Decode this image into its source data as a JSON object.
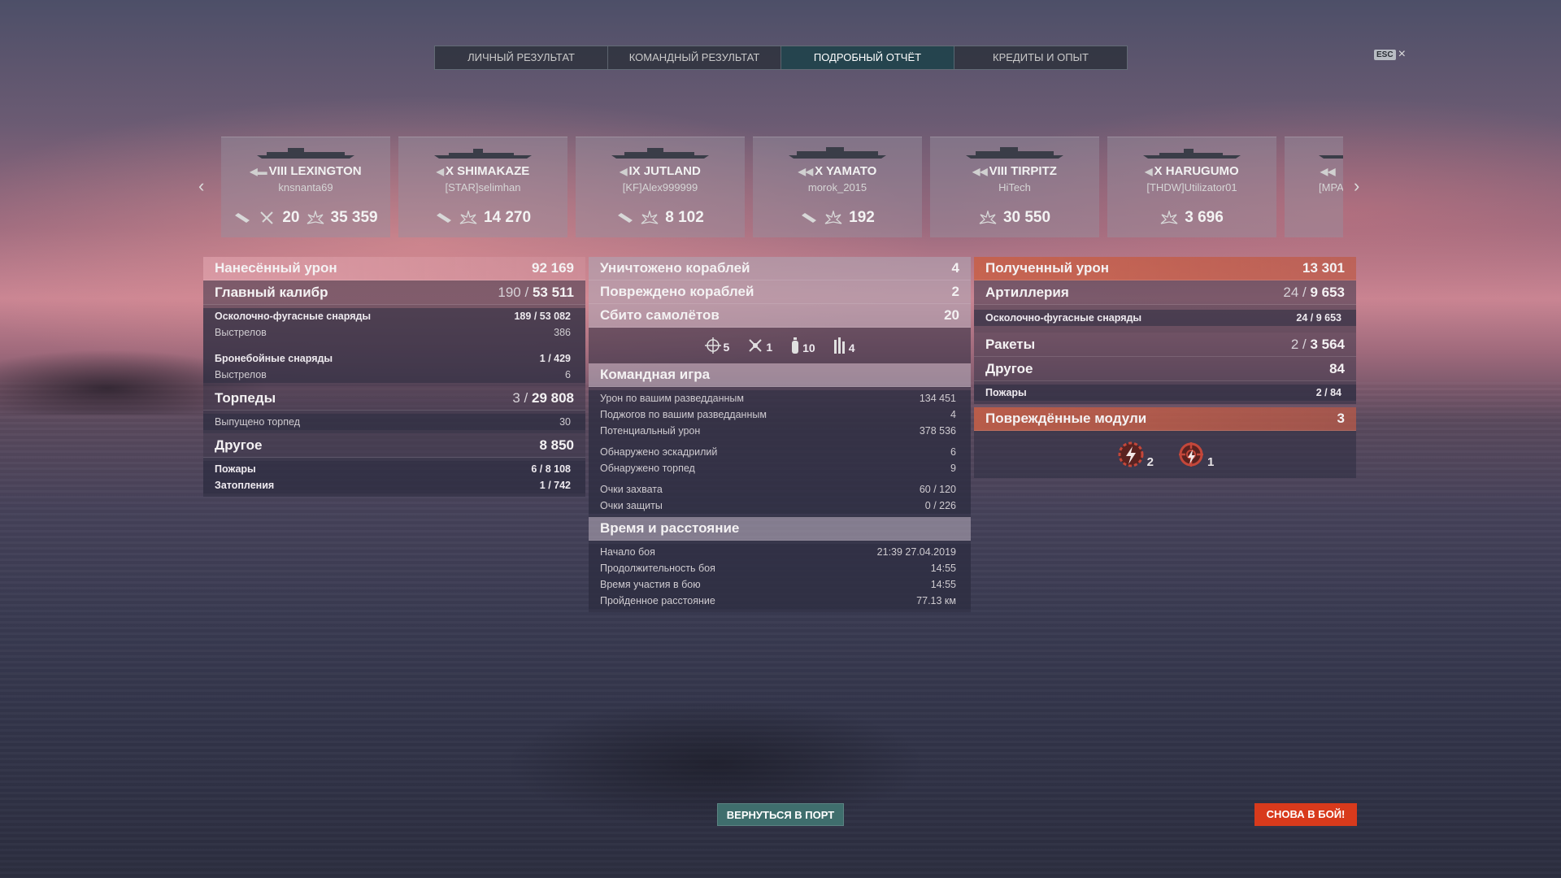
{
  "tabs": [
    {
      "label": "ЛИЧНЫЙ РЕЗУЛЬТАТ"
    },
    {
      "label": "КОМАНДНЫЙ РЕЗУЛЬТАТ"
    },
    {
      "label": "ПОДРОБНЫЙ ОТЧЁТ",
      "active": true
    },
    {
      "label": "КРЕДИТЫ И ОПЫТ"
    }
  ],
  "esc": {
    "key": "ESC",
    "close": "×"
  },
  "cards": [
    {
      "name": "VIII LEXINGTON",
      "player": "knsnanta69",
      "planes": "20",
      "damage": "35 359"
    },
    {
      "name": "X SHIMAKAZE",
      "player": "[STAR]selimhan",
      "damage": "14 270"
    },
    {
      "name": "IX JUTLAND",
      "player": "[KF]Alex999999",
      "damage": "8 102"
    },
    {
      "name": "X YAMATO",
      "player": "morok_2015",
      "damage": "192"
    },
    {
      "name": "VIII TIRPITZ",
      "player": "HiTech",
      "damage": "30 550"
    },
    {
      "name": "X HARUGUMO",
      "player": "[THDW]Utilizator01",
      "damage": "3 696"
    },
    {
      "name": "",
      "player": "[MPA"
    }
  ],
  "dealt": {
    "title": "Нанесённый урон",
    "value": "92 169",
    "main": {
      "label": "Главный калибр",
      "hits": "190",
      "dmg": "53 511"
    },
    "he": {
      "label": "Осколочно-фугасные снаряды",
      "value": "189 / 53 082"
    },
    "he_shots": {
      "label": "Выстрелов",
      "value": "386"
    },
    "ap": {
      "label": "Бронебойные снаряды",
      "value": "1 / 429"
    },
    "ap_shots": {
      "label": "Выстрелов",
      "value": "6"
    },
    "torps": {
      "label": "Торпеды",
      "hits": "3",
      "dmg": "29 808"
    },
    "torps_launched": {
      "label": "Выпущено торпед",
      "value": "30"
    },
    "other": {
      "label": "Другое",
      "value": "8 850"
    },
    "fires": {
      "label": "Пожары",
      "value": "6 / 8 108"
    },
    "floods": {
      "label": "Затопления",
      "value": "1 / 742"
    }
  },
  "center": {
    "destroyed": {
      "label": "Уничтожено кораблей",
      "value": "4"
    },
    "damaged": {
      "label": "Повреждено кораблей",
      "value": "2"
    },
    "planes": {
      "label": "Сбито самолётов",
      "value": "20"
    },
    "plane_icons": [
      {
        "icon": "crosshair-icon",
        "value": "5"
      },
      {
        "icon": "fighter-plane-icon",
        "value": "1"
      },
      {
        "icon": "bomb-icon",
        "value": "10"
      },
      {
        "icon": "torpedo-bomber-icon",
        "value": "4"
      }
    ],
    "team": {
      "title": "Командная игра",
      "rows": [
        {
          "label": "Урон по вашим разведданным",
          "value": "134 451"
        },
        {
          "label": "Поджогов по вашим разведданным",
          "value": "4"
        },
        {
          "label": "Потенциальный урон",
          "value": "378 536"
        },
        {
          "label": "Обнаружено эскадрилий",
          "value": "6"
        },
        {
          "label": "Обнаружено торпед",
          "value": "9"
        },
        {
          "label": "Очки захвата",
          "value": "60 / 120"
        },
        {
          "label": "Очки защиты",
          "value": "0 / 226"
        }
      ]
    },
    "time": {
      "title": "Время и расстояние",
      "rows": [
        {
          "label": "Начало боя",
          "value": "21:39  27.04.2019"
        },
        {
          "label": "Продолжительность боя",
          "value": "14:55"
        },
        {
          "label": "Время участия в бою",
          "value": "14:55"
        },
        {
          "label": "Пройденное расстояние",
          "value": "77.13 км"
        }
      ]
    }
  },
  "received": {
    "title": "Полученный урон",
    "value": "13 301",
    "artillery": {
      "label": "Артиллерия",
      "hits": "24",
      "dmg": "9 653"
    },
    "he": {
      "label": "Осколочно-фугасные снаряды",
      "value": "24 / 9 653"
    },
    "rockets": {
      "label": "Ракеты",
      "hits": "2",
      "dmg": "3 564"
    },
    "other": {
      "label": "Другое",
      "value": "84"
    },
    "fires": {
      "label": "Пожары",
      "value": "2 / 84"
    },
    "modules": {
      "label": "Повреждённые модули",
      "value": "3"
    },
    "module_icons": [
      {
        "icon": "engine-damage-icon",
        "value": "2"
      },
      {
        "icon": "steering-damage-icon",
        "value": "1"
      }
    ]
  },
  "buttons": {
    "port": "ВЕРНУТЬСЯ В ПОРТ",
    "battle": "СНОВА В БОЙ!"
  },
  "colors": {
    "orange_header": "#c85f46",
    "battle_button": "#d83a1c",
    "port_button": "#3f6e6d"
  }
}
